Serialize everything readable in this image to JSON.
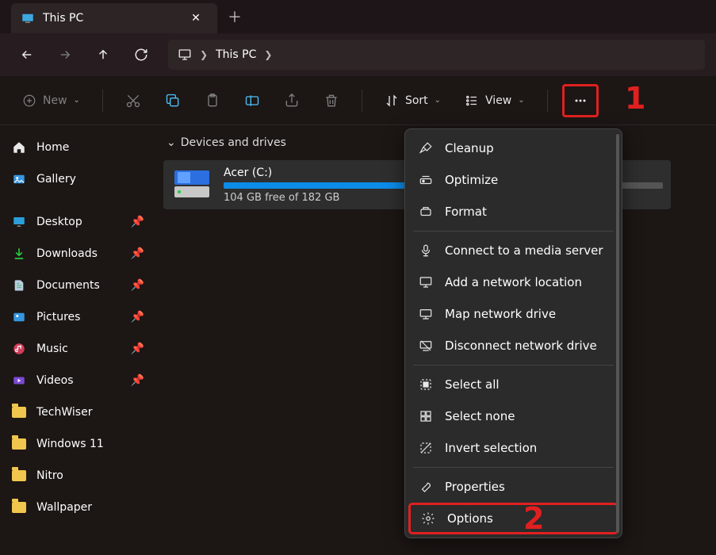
{
  "tab": {
    "title": "This PC"
  },
  "breadcrumb": {
    "location": "This PC"
  },
  "toolbar": {
    "new": "New",
    "sort": "Sort",
    "view": "View"
  },
  "annotations": {
    "more": "1",
    "options": "2"
  },
  "sidebar": {
    "home": "Home",
    "gallery": "Gallery",
    "desktop": "Desktop",
    "downloads": "Downloads",
    "documents": "Documents",
    "pictures": "Pictures",
    "music": "Music",
    "videos": "Videos",
    "techwiser": "TechWiser",
    "windows11": "Windows 11",
    "nitro": "Nitro",
    "wallpaper": "Wallpaper"
  },
  "section": {
    "devices": "Devices and drives"
  },
  "drive": {
    "name": "Acer (C:)",
    "free": "104 GB free of 182 GB",
    "used_pct": 43
  },
  "menu": {
    "cleanup": "Cleanup",
    "optimize": "Optimize",
    "format": "Format",
    "connect_media": "Connect to a media server",
    "add_network": "Add a network location",
    "map_drive": "Map network drive",
    "disconnect_drive": "Disconnect network drive",
    "select_all": "Select all",
    "select_none": "Select none",
    "invert_selection": "Invert selection",
    "properties": "Properties",
    "options": "Options"
  }
}
